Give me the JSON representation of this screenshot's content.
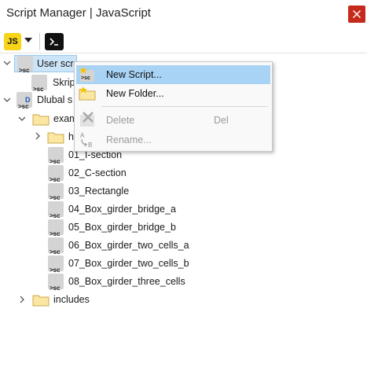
{
  "window": {
    "title": "Script Manager | JavaScript"
  },
  "toolbar": {
    "language_badge": "JS"
  },
  "tree": {
    "user_scripts": {
      "label": "User scr"
    },
    "user_child": {
      "label": "Skrip"
    },
    "dlubal": {
      "label": "Dlubal s"
    },
    "examples": {
      "label": "exam"
    },
    "sub_folder": {
      "label": "h"
    },
    "scripts": [
      "01_I-section",
      "02_C-section",
      "03_Rectangle",
      "04_Box_girder_bridge_a",
      "05_Box_girder_bridge_b",
      "06_Box_girder_two_cells_a",
      "07_Box_girder_two_cells_b",
      "08_Box_girder_three_cells"
    ],
    "includes": {
      "label": "includes"
    }
  },
  "context_menu": {
    "new_script": "New Script...",
    "new_folder": "New Folder...",
    "delete": "Delete",
    "delete_shortcut": "Del",
    "rename": "Rename..."
  },
  "icons": {
    "sc_badge": ">sc",
    "dlubal_badge": "D"
  }
}
